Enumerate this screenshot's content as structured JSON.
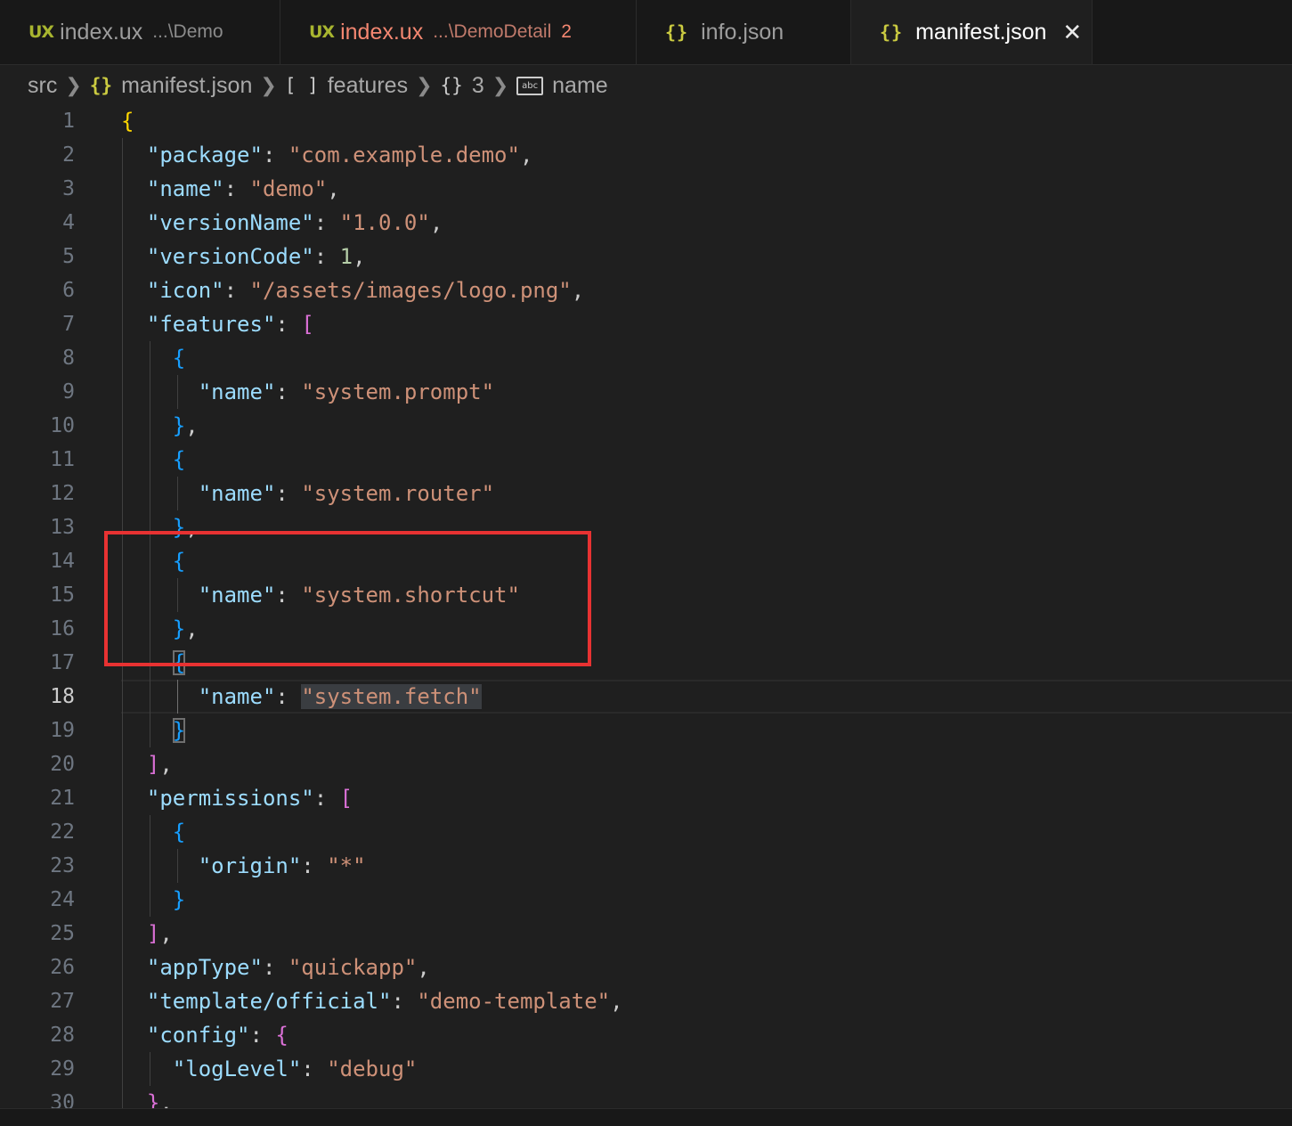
{
  "tabs": [
    {
      "icon_text": "UX",
      "label": "index.ux",
      "path": "...\\Demo",
      "badge": ""
    },
    {
      "icon_text": "UX",
      "label": "index.ux",
      "path": "...\\DemoDetail",
      "badge": "2"
    },
    {
      "icon_text": "{}",
      "label": "info.json",
      "path": "",
      "badge": ""
    },
    {
      "icon_text": "{}",
      "label": "manifest.json",
      "path": "",
      "badge": "",
      "close": "✕"
    }
  ],
  "breadcrumb": {
    "root": "src",
    "file_icon": "{}",
    "file": "manifest.json",
    "array_icon": "[ ]",
    "array": "features",
    "object_icon": "{}",
    "index": "3",
    "string_icon": "abc",
    "leaf": "name"
  },
  "editor": {
    "current_line": 18,
    "lines": [
      {
        "n": "1"
      },
      {
        "n": "2"
      },
      {
        "n": "3"
      },
      {
        "n": "4"
      },
      {
        "n": "5"
      },
      {
        "n": "6"
      },
      {
        "n": "7"
      },
      {
        "n": "8"
      },
      {
        "n": "9"
      },
      {
        "n": "10"
      },
      {
        "n": "11"
      },
      {
        "n": "12"
      },
      {
        "n": "13"
      },
      {
        "n": "14"
      },
      {
        "n": "15"
      },
      {
        "n": "16"
      },
      {
        "n": "17"
      },
      {
        "n": "18"
      },
      {
        "n": "19"
      },
      {
        "n": "20"
      },
      {
        "n": "21"
      },
      {
        "n": "22"
      },
      {
        "n": "23"
      },
      {
        "n": "24"
      },
      {
        "n": "25"
      },
      {
        "n": "26"
      },
      {
        "n": "27"
      },
      {
        "n": "28"
      },
      {
        "n": "29"
      },
      {
        "n": "30"
      }
    ],
    "code": {
      "k_package": "\"package\"",
      "v_package": "\"com.example.demo\"",
      "k_name": "\"name\"",
      "v_name": "\"demo\"",
      "k_versionName": "\"versionName\"",
      "v_versionName": "\"1.0.0\"",
      "k_versionCode": "\"versionCode\"",
      "v_versionCode": "1",
      "k_icon": "\"icon\"",
      "v_icon": "\"/assets/images/logo.png\"",
      "k_features": "\"features\"",
      "k_feat_name": "\"name\"",
      "v_feat1": "\"system.prompt\"",
      "v_feat2": "\"system.router\"",
      "v_feat3": "\"system.shortcut\"",
      "v_feat4": "\"system.fetch\"",
      "k_permissions": "\"permissions\"",
      "k_origin": "\"origin\"",
      "v_origin": "\"*\"",
      "k_appType": "\"appType\"",
      "v_appType": "\"quickapp\"",
      "k_template": "\"template/official\"",
      "v_template": "\"demo-template\"",
      "k_config": "\"config\"",
      "k_logLevel": "\"logLevel\"",
      "v_logLevel": "\"debug\""
    }
  },
  "colors": {
    "background": "#1f1f1f",
    "key": "#9cdcfe",
    "string": "#ce9178",
    "number": "#b5cea8",
    "annotation_box": "#e83232"
  }
}
